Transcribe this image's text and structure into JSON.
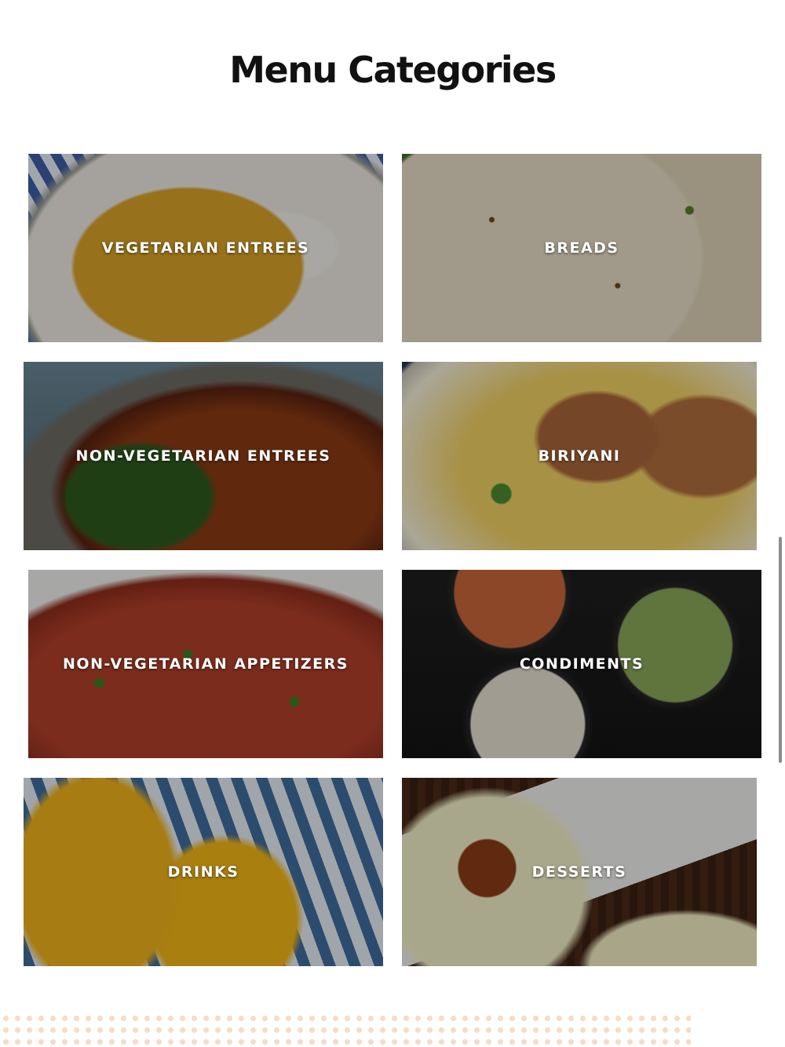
{
  "page": {
    "title": "Menu Categories"
  },
  "categories": [
    {
      "label": "VEGETARIAN ENTREES",
      "image_desc": "yellow vegetable curry with rice"
    },
    {
      "label": "BREADS",
      "image_desc": "naan bread with herbs"
    },
    {
      "label": "NON-VEGETARIAN ENTREES",
      "image_desc": "chicken curry in pot"
    },
    {
      "label": "BIRIYANI",
      "image_desc": "chicken biryani rice"
    },
    {
      "label": "NON-VEGETARIAN APPETIZERS",
      "image_desc": "chili chicken with herbs"
    },
    {
      "label": "CONDIMENTS",
      "image_desc": "chutneys in black bowls"
    },
    {
      "label": "DRINKS",
      "image_desc": "mango lassi in glasses"
    },
    {
      "label": "DESSERTS",
      "image_desc": "gulab jamun in rabdi"
    }
  ]
}
